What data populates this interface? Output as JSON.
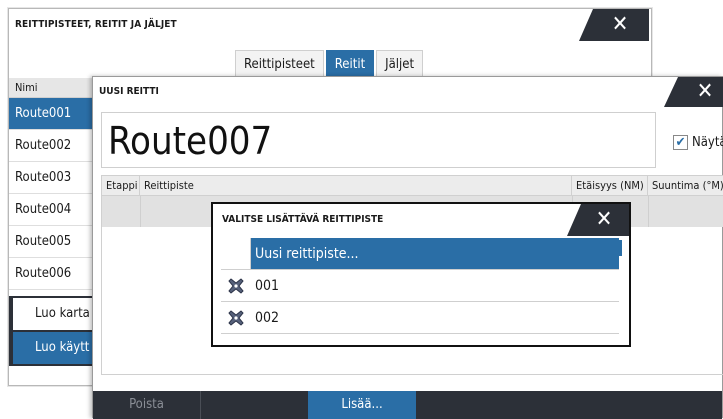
{
  "back_window": {
    "title": "REITTIPISTEET, REITIT JA JÄLJET",
    "close_symbol": "✕",
    "tabs": [
      {
        "label": "Reittipisteet",
        "active": false
      },
      {
        "label": "Reitit",
        "active": true
      },
      {
        "label": "Jäljet",
        "active": false
      }
    ],
    "list_header": "Nimi",
    "routes": [
      {
        "label": "Route001",
        "selected": true
      },
      {
        "label": "Route002",
        "selected": false
      },
      {
        "label": "Route003",
        "selected": false
      },
      {
        "label": "Route004",
        "selected": false
      },
      {
        "label": "Route005",
        "selected": false
      },
      {
        "label": "Route006",
        "selected": false
      }
    ],
    "button_create_chart": "Luo karta",
    "button_create_use": "Luo käytt"
  },
  "new_route": {
    "title": "UUSI REITTI",
    "close_symbol": "✕",
    "route_name": "Route007",
    "show_label": "Näytä",
    "show_checked": true,
    "columns": {
      "etappi": "Etappi",
      "reittipiste": "Reittipiste",
      "etaisyys": "Etäisyys (NM)",
      "suuntima": "Suuntima (°M)"
    },
    "delete_button": "Poista",
    "add_button": "Lisää..."
  },
  "dialog": {
    "title": "VALITSE LISÄTTÄVÄ REITTIPISTE",
    "close_symbol": "✕",
    "new_waypoint": "Uusi reittipiste...",
    "waypoints": [
      {
        "label": "001",
        "icon": "waypoint-x-icon"
      },
      {
        "label": "002",
        "icon": "waypoint-x-icon"
      }
    ]
  },
  "colors": {
    "accent_blue": "#2a6ea6",
    "dark_bar": "#2c3038",
    "waypoint_icon": "#55607a"
  }
}
